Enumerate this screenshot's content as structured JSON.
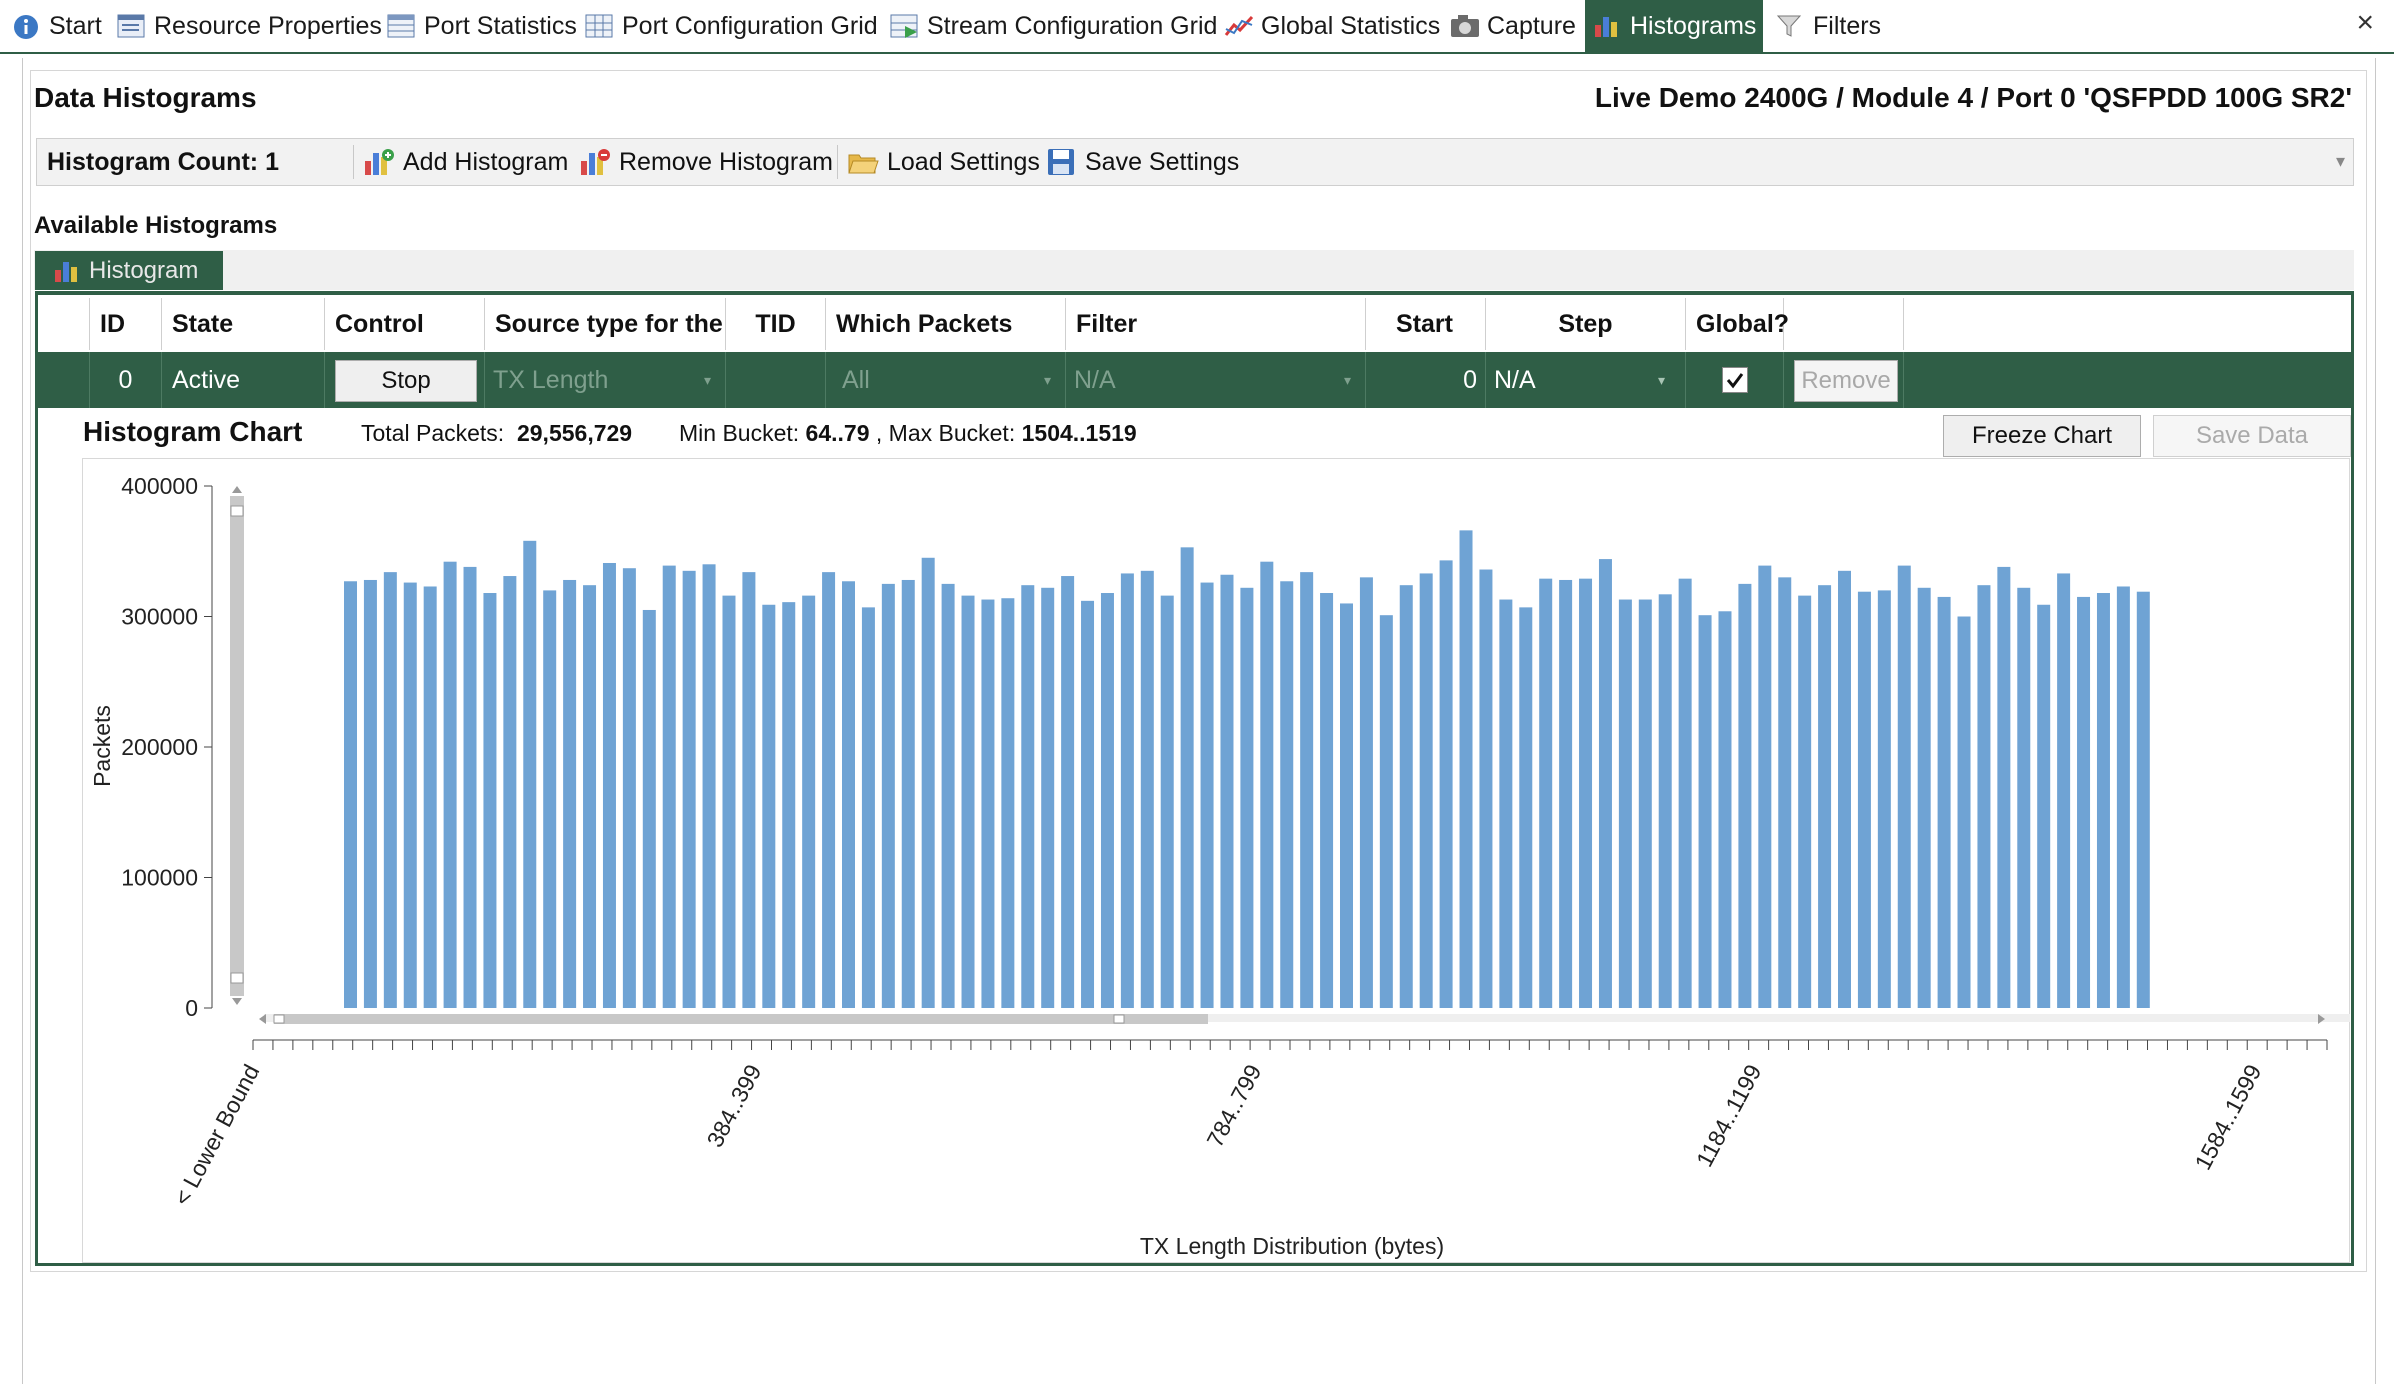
{
  "tabs": [
    {
      "label": "Start",
      "icon": "info-icon"
    },
    {
      "label": "Resource Properties",
      "icon": "properties-icon"
    },
    {
      "label": "Port Statistics",
      "icon": "table-icon"
    },
    {
      "label": "Port Configuration Grid",
      "icon": "grid-icon"
    },
    {
      "label": "Stream Configuration Grid",
      "icon": "stream-grid-icon"
    },
    {
      "label": "Global Statistics",
      "icon": "line-chart-icon"
    },
    {
      "label": "Capture",
      "icon": "camera-icon"
    },
    {
      "label": "Histograms",
      "icon": "bar-chart-icon",
      "active": true
    },
    {
      "label": "Filters",
      "icon": "funnel-icon"
    }
  ],
  "close_label": "×",
  "page": {
    "title": "Data Histograms",
    "port_path": "Live Demo 2400G / Module 4 / Port 0 'QSFPDD 100G SR2'"
  },
  "toolbar": {
    "count_label": "Histogram Count:",
    "count_value": "1",
    "add": "Add Histogram",
    "remove": "Remove Histogram",
    "load": "Load Settings",
    "save": "Save Settings"
  },
  "available_label": "Available Histograms",
  "subtab_label": "Histogram",
  "grid": {
    "headers": [
      "ID",
      "State",
      "Control",
      "Source type for the",
      "TID",
      "Which Packets",
      "Filter",
      "Start",
      "Step",
      "Global?"
    ],
    "row": {
      "id": "0",
      "state": "Active",
      "control": "Stop",
      "source": "TX Length",
      "tid": "",
      "which": "All",
      "filter": "N/A",
      "start": "0",
      "step": "N/A",
      "global": true,
      "remove": "Remove"
    }
  },
  "chart_panel": {
    "title": "Histogram Chart",
    "total_label": "Total Packets:",
    "total_value": "29,556,729",
    "min_label": "Min Bucket:",
    "min_value": "64..79",
    "max_label": ", Max Bucket:",
    "max_value": "1504..1519",
    "freeze": "Freeze Chart",
    "save_data": "Save Data"
  },
  "colors": {
    "accent": "#2f5e46",
    "bar": "#6fa3d4"
  },
  "chart_data": {
    "type": "bar",
    "xlabel": "TX Length Distribution (bytes)",
    "ylabel": "Packets",
    "ylim": [
      0,
      400000
    ],
    "yticks": [
      "400000",
      "300000",
      "200000",
      "100000",
      "0"
    ],
    "xtick_labels": [
      "< Lower Bound",
      "384..399",
      "784..799",
      "1184..1199",
      "1584..1599"
    ],
    "bucket_width": 16,
    "first_bucket": "64..79",
    "last_bucket": "1504..1519",
    "values": [
      327000,
      328000,
      334000,
      326000,
      323000,
      342000,
      338000,
      318000,
      331000,
      358000,
      320000,
      328000,
      324000,
      341000,
      337000,
      305000,
      339000,
      335000,
      340000,
      316000,
      334000,
      309000,
      311000,
      316000,
      334000,
      327000,
      307000,
      325000,
      328000,
      345000,
      325000,
      316000,
      313000,
      314000,
      324000,
      322000,
      331000,
      312000,
      318000,
      333000,
      335000,
      316000,
      353000,
      326000,
      332000,
      322000,
      342000,
      327000,
      334000,
      318000,
      310000,
      330000,
      301000,
      324000,
      333000,
      343000,
      366000,
      336000,
      313000,
      307000,
      329000,
      328000,
      329000,
      344000,
      313000,
      313000,
      317000,
      329000,
      301000,
      304000,
      325000,
      339000,
      330000,
      316000,
      324000,
      335000,
      319000,
      320000,
      339000,
      322000,
      315000,
      300000,
      324000,
      338000,
      322000,
      309000,
      333000,
      315000,
      318000,
      323000,
      319000
    ]
  }
}
